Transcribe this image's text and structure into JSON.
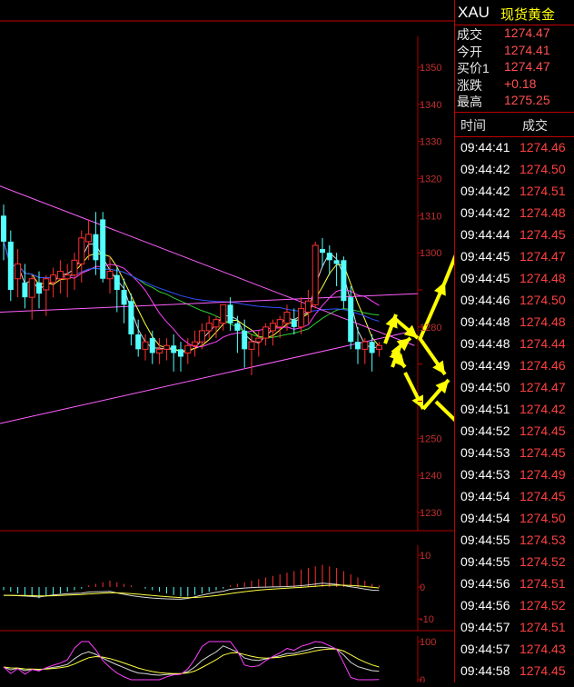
{
  "header": {
    "symbol": "XAU",
    "name": "现货黄金"
  },
  "quote": [
    {
      "label": "成交",
      "value": "1274.47"
    },
    {
      "label": "今开",
      "value": "1274.41"
    },
    {
      "label": "买价1",
      "value": "1274.47"
    },
    {
      "label": "涨跌",
      "value": "+0.18"
    },
    {
      "label": "最高",
      "value": "1275.25"
    }
  ],
  "ticks": {
    "time_header": "时间",
    "price_header": "成交",
    "rows": [
      {
        "time": "09:44:41",
        "price": "1274.46"
      },
      {
        "time": "09:44:42",
        "price": "1274.50"
      },
      {
        "time": "09:44:42",
        "price": "1274.51"
      },
      {
        "time": "09:44:42",
        "price": "1274.48"
      },
      {
        "time": "09:44:44",
        "price": "1274.45"
      },
      {
        "time": "09:44:45",
        "price": "1274.47"
      },
      {
        "time": "09:44:45",
        "price": "1274.48"
      },
      {
        "time": "09:44:46",
        "price": "1274.50"
      },
      {
        "time": "09:44:48",
        "price": "1274.48"
      },
      {
        "time": "09:44:48",
        "price": "1274.44"
      },
      {
        "time": "09:44:49",
        "price": "1274.46"
      },
      {
        "time": "09:44:50",
        "price": "1274.47"
      },
      {
        "time": "09:44:51",
        "price": "1274.42"
      },
      {
        "time": "09:44:52",
        "price": "1274.45"
      },
      {
        "time": "09:44:53",
        "price": "1274.45"
      },
      {
        "time": "09:44:53",
        "price": "1274.49"
      },
      {
        "time": "09:44:54",
        "price": "1274.45"
      },
      {
        "time": "09:44:54",
        "price": "1274.50"
      },
      {
        "time": "09:44:55",
        "price": "1274.53"
      },
      {
        "time": "09:44:55",
        "price": "1274.52"
      },
      {
        "time": "09:44:56",
        "price": "1274.51"
      },
      {
        "time": "09:44:56",
        "price": "1274.52"
      },
      {
        "time": "09:44:57",
        "price": "1274.51"
      },
      {
        "time": "09:44:57",
        "price": "1274.43"
      },
      {
        "time": "09:44:58",
        "price": "1274.45"
      }
    ]
  },
  "colors": {
    "up": "#ff3030",
    "down": "#54ffff",
    "grid": "#8b0000",
    "axis_text": "#c03030",
    "ma_white": "#d8d8d8",
    "ma_yellow": "#ffff40",
    "ma_magenta": "#ff40ff",
    "ma_green": "#30d030",
    "ma_blue": "#3050ff",
    "trendline": "#ff60ff",
    "arrow": "#ffff00"
  },
  "chart_data": [
    {
      "type": "candlestick",
      "price_ticks": [
        1350,
        1340,
        1330,
        1320,
        1310,
        1300,
        1290,
        1280,
        1270,
        1260,
        1250,
        1240,
        1230
      ],
      "price_tick_labels_visible": [
        "1350",
        "1340",
        "1330",
        "1320",
        "1310",
        "1300",
        "",
        "1280",
        "",
        "",
        "1250",
        "1240",
        "1230"
      ],
      "ylim": [
        1226,
        1358
      ],
      "candles": [
        {
          "o": 1310,
          "h": 1313,
          "c": 1303,
          "l": 1298
        },
        {
          "o": 1303,
          "h": 1306,
          "c": 1290,
          "l": 1287
        },
        {
          "o": 1293,
          "h": 1301,
          "c": 1297,
          "l": 1288
        },
        {
          "o": 1292,
          "h": 1297,
          "c": 1288,
          "l": 1285
        },
        {
          "o": 1288,
          "h": 1294,
          "c": 1293,
          "l": 1282
        },
        {
          "o": 1292,
          "h": 1295,
          "c": 1289,
          "l": 1285
        },
        {
          "o": 1290,
          "h": 1294,
          "c": 1293,
          "l": 1283
        },
        {
          "o": 1292,
          "h": 1296,
          "c": 1294,
          "l": 1288
        },
        {
          "o": 1293,
          "h": 1298,
          "c": 1295,
          "l": 1289
        },
        {
          "o": 1293,
          "h": 1297,
          "c": 1294,
          "l": 1288
        },
        {
          "o": 1294,
          "h": 1300,
          "c": 1298,
          "l": 1290
        },
        {
          "o": 1297,
          "h": 1306,
          "c": 1304,
          "l": 1292
        },
        {
          "o": 1303,
          "h": 1309,
          "c": 1305,
          "l": 1298
        },
        {
          "o": 1305,
          "h": 1311,
          "c": 1298,
          "l": 1294
        },
        {
          "o": 1309,
          "h": 1311,
          "c": 1293,
          "l": 1292
        },
        {
          "o": 1293,
          "h": 1299,
          "c": 1295,
          "l": 1289
        },
        {
          "o": 1294,
          "h": 1296,
          "c": 1290,
          "l": 1284
        },
        {
          "o": 1290,
          "h": 1293,
          "c": 1286,
          "l": 1281
        },
        {
          "o": 1287,
          "h": 1289,
          "c": 1278,
          "l": 1275
        },
        {
          "o": 1278,
          "h": 1282,
          "c": 1274,
          "l": 1272
        },
        {
          "o": 1274,
          "h": 1278,
          "c": 1276,
          "l": 1271
        },
        {
          "o": 1277,
          "h": 1279,
          "c": 1273,
          "l": 1270
        },
        {
          "o": 1273,
          "h": 1277,
          "c": 1274,
          "l": 1270
        },
        {
          "o": 1274,
          "h": 1277,
          "c": 1275,
          "l": 1271
        },
        {
          "o": 1275,
          "h": 1278,
          "c": 1273,
          "l": 1268
        },
        {
          "o": 1274,
          "h": 1276,
          "c": 1272,
          "l": 1268
        },
        {
          "o": 1273,
          "h": 1277,
          "c": 1275,
          "l": 1270
        },
        {
          "o": 1275,
          "h": 1279,
          "c": 1276,
          "l": 1272
        },
        {
          "o": 1276,
          "h": 1281,
          "c": 1279,
          "l": 1274
        },
        {
          "o": 1279,
          "h": 1283,
          "c": 1281,
          "l": 1277
        },
        {
          "o": 1280,
          "h": 1283,
          "c": 1282,
          "l": 1277
        },
        {
          "o": 1281,
          "h": 1283,
          "c": 1286,
          "l": 1279
        },
        {
          "o": 1286,
          "h": 1288,
          "c": 1281,
          "l": 1279
        },
        {
          "o": 1281,
          "h": 1283,
          "c": 1279,
          "l": 1273
        },
        {
          "o": 1279,
          "h": 1282,
          "c": 1274,
          "l": 1269
        },
        {
          "o": 1274,
          "h": 1278,
          "c": 1276,
          "l": 1267
        },
        {
          "o": 1276,
          "h": 1279,
          "c": 1277,
          "l": 1272
        },
        {
          "o": 1277,
          "h": 1281,
          "c": 1280,
          "l": 1275
        },
        {
          "o": 1279,
          "h": 1282,
          "c": 1281,
          "l": 1275
        },
        {
          "o": 1280,
          "h": 1283,
          "c": 1282,
          "l": 1277
        },
        {
          "o": 1281,
          "h": 1286,
          "c": 1284,
          "l": 1279
        },
        {
          "o": 1282,
          "h": 1285,
          "c": 1280,
          "l": 1278
        },
        {
          "o": 1280,
          "h": 1288,
          "c": 1285,
          "l": 1278
        },
        {
          "o": 1284,
          "h": 1290,
          "c": 1287,
          "l": 1281
        },
        {
          "o": 1286,
          "h": 1303,
          "c": 1302,
          "l": 1285
        },
        {
          "o": 1301,
          "h": 1304,
          "c": 1300,
          "l": 1296
        },
        {
          "o": 1300,
          "h": 1302,
          "c": 1298,
          "l": 1294
        },
        {
          "o": 1298,
          "h": 1300,
          "c": 1297,
          "l": 1291
        },
        {
          "o": 1298,
          "h": 1299,
          "c": 1287,
          "l": 1285
        },
        {
          "o": 1288,
          "h": 1291,
          "c": 1276,
          "l": 1274
        },
        {
          "o": 1276,
          "h": 1280,
          "c": 1274,
          "l": 1270
        },
        {
          "o": 1274,
          "h": 1277,
          "c": 1276,
          "l": 1270
        },
        {
          "o": 1276,
          "h": 1278,
          "c": 1273,
          "l": 1268
        },
        {
          "o": 1274,
          "h": 1276,
          "c": 1275,
          "l": 1272
        }
      ]
    },
    {
      "type": "bar",
      "indicator": "MACD",
      "tick_labels": [
        "10",
        "0",
        "-10"
      ],
      "ylim": [
        -12,
        12
      ],
      "values": [
        -1,
        -1.5,
        -2,
        -2.5,
        -3,
        -3.5,
        -3,
        -2.5,
        -2,
        -1.5,
        -1,
        -0.5,
        0.5,
        1,
        1.5,
        2,
        1.5,
        1,
        0.5,
        0,
        -0.5,
        -1,
        -1.5,
        -2,
        -2.5,
        -3,
        -3,
        -2.5,
        -2,
        -1.5,
        -1,
        -0.5,
        0.5,
        1,
        1.5,
        2,
        2.5,
        3,
        3.5,
        4,
        4.5,
        5,
        5.5,
        6,
        6.5,
        7,
        6.5,
        6,
        5,
        4,
        3,
        2,
        1,
        0.5
      ]
    },
    {
      "type": "line",
      "indicator": "KDJ",
      "tick_labels": [
        "100",
        "0"
      ],
      "ylim": [
        0,
        100
      ]
    }
  ]
}
